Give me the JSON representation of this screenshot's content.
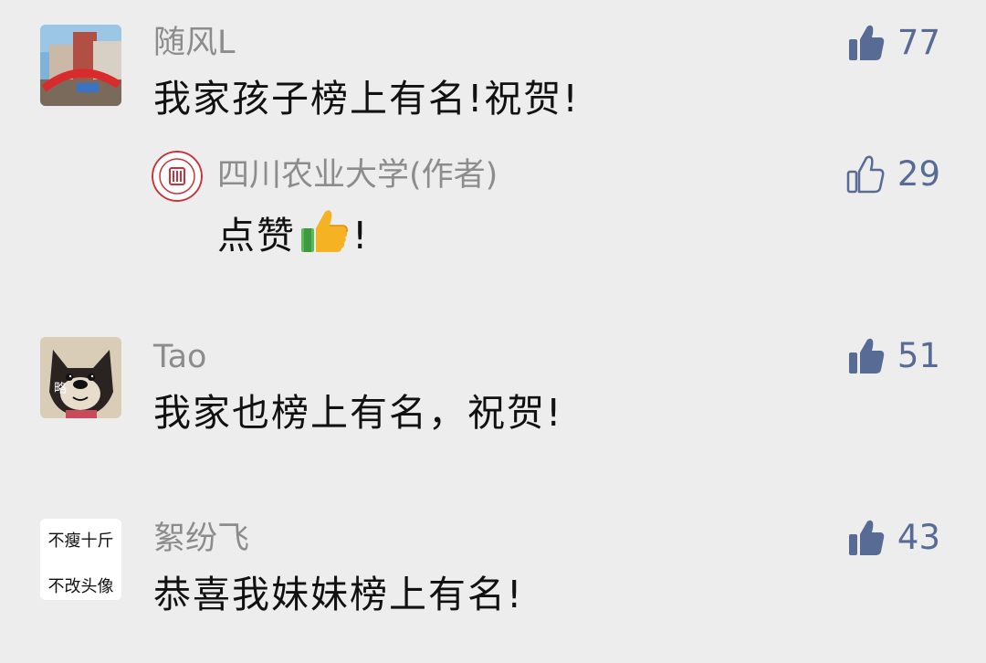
{
  "comments": [
    {
      "author": "随风L",
      "text": "我家孩子榜上有名!祝贺!",
      "likes": "77",
      "liked": true,
      "avatar_icon": "campus-photo-avatar",
      "reply": {
        "author": "四川农业大学(作者)",
        "text_prefix": "点赞",
        "text_suffix": "!",
        "emoji": "thumbs-up-emoji",
        "likes": "29",
        "liked": false,
        "avatar_icon": "university-seal-avatar"
      }
    },
    {
      "author": "Tao",
      "text": "我家也榜上有名，祝贺!",
      "likes": "51",
      "liked": true,
      "avatar_icon": "shiba-dog-avatar",
      "avatar_badge": "略"
    },
    {
      "author": "絮纷飞",
      "text": "恭喜我妹妹榜上有名!",
      "likes": "43",
      "liked": true,
      "avatar_icon": "text-avatar",
      "avatar_lines": [
        "不瘦十斤",
        "不改头像"
      ]
    }
  ],
  "colors": {
    "background": "#ededed",
    "name": "#8c8c8c",
    "text": "#111111",
    "like_accent": "#576b95",
    "seal_red": "#c8333a"
  }
}
